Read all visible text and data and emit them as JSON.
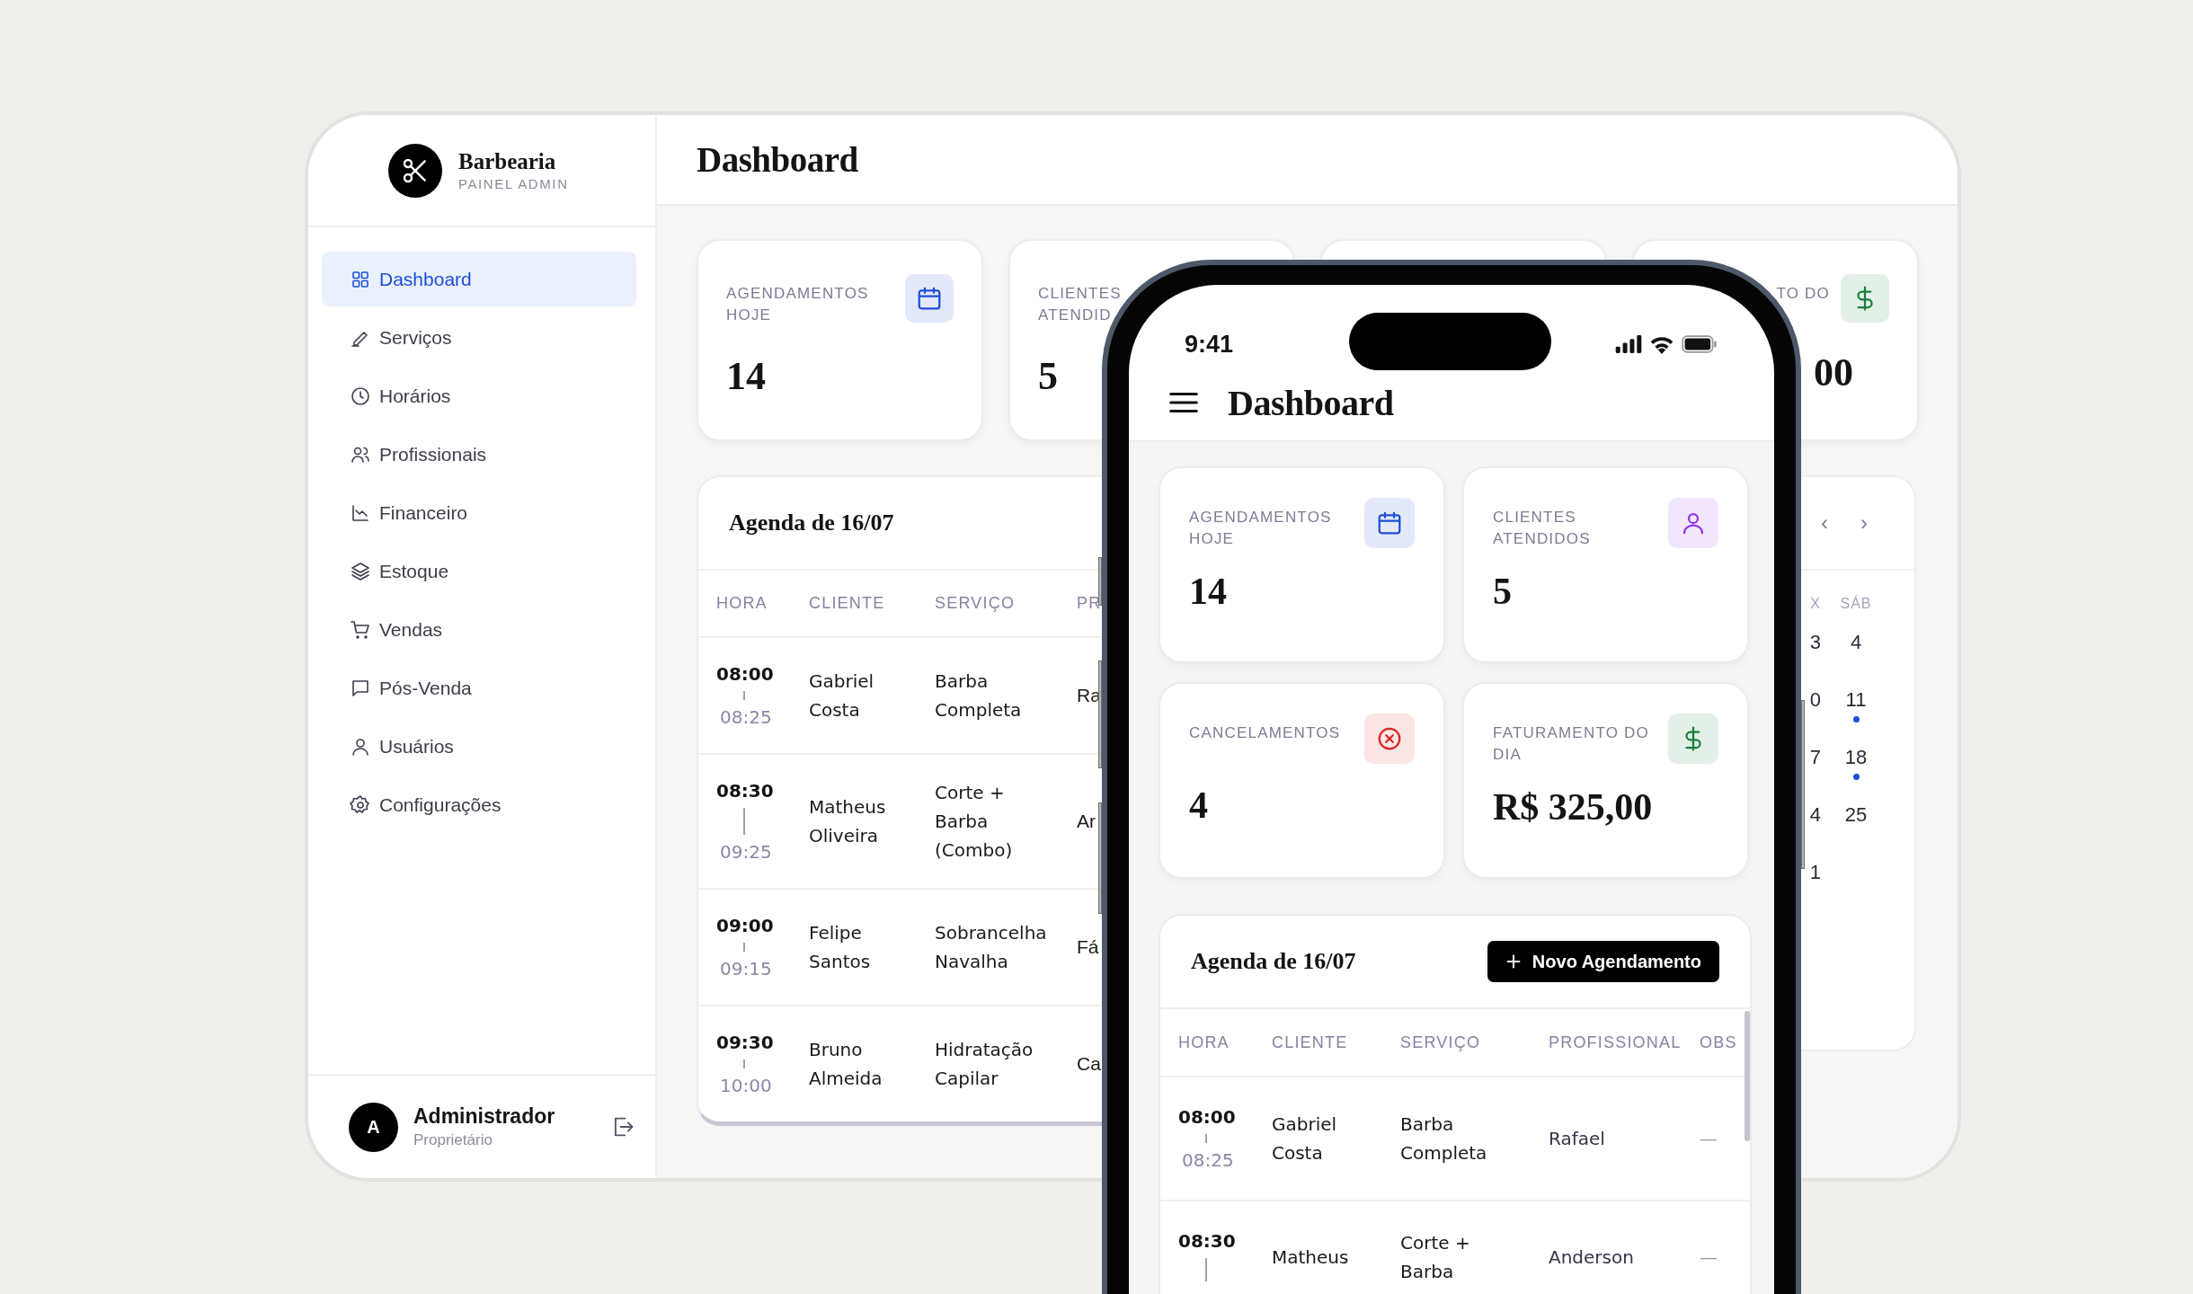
{
  "sidebar": {
    "brand": {
      "name": "Barbearia",
      "subtitle": "PAINEL ADMIN"
    },
    "items": [
      {
        "label": "Dashboard",
        "selected": true
      },
      {
        "label": "Serviços",
        "selected": false
      },
      {
        "label": "Horários",
        "selected": false
      },
      {
        "label": "Profissionais",
        "selected": false
      },
      {
        "label": "Financeiro",
        "selected": false
      },
      {
        "label": "Estoque",
        "selected": false
      },
      {
        "label": "Vendas",
        "selected": false
      },
      {
        "label": "Pós-Venda",
        "selected": false
      },
      {
        "label": "Usuários",
        "selected": false
      },
      {
        "label": "Configurações",
        "selected": false
      }
    ],
    "user": {
      "initial": "A",
      "name": "Administrador",
      "role": "Proprietário"
    }
  },
  "header": {
    "title": "Dashboard"
  },
  "stat_cards": [
    {
      "kind": "stat",
      "label": "AGENDAMENTOS HOJE",
      "value": "14",
      "color": "#1d4ed8"
    },
    {
      "kind": "stat",
      "label": "CLIENTES ATENDID",
      "value": "5"
    },
    {
      "kind": "covered"
    },
    {
      "kind": "stat",
      "label": "TO DO",
      "value": "00",
      "color": "#15803d"
    }
  ],
  "agenda": {
    "title": "Agenda de 16/07",
    "columns": [
      "HORA",
      "CLIENTE",
      "SERVIÇO",
      "PR"
    ],
    "rows": [
      {
        "start": "08:00",
        "end": "08:25",
        "client": "Gabriel Costa",
        "service": "Barba Completa",
        "column_4": "Ra"
      },
      {
        "start": "08:30",
        "end": "09:25",
        "client": "Matheus Oliveira",
        "service": "Corte + Barba (Combo)",
        "column_4": "Ar"
      },
      {
        "start": "09:00",
        "end": "09:15",
        "client": "Felipe Santos",
        "service": "Sobrancelha Navalha",
        "column_4": "Fá"
      },
      {
        "start": "09:30",
        "end": "10:00",
        "client": "Bruno Almeida",
        "service": "Hidratação Capilar",
        "column_4": "Ca"
      }
    ]
  },
  "calendar": {
    "nav": [
      "‹",
      "›"
    ],
    "columns": [
      "X",
      "SÁB"
    ],
    "weeks": [
      [
        {
          "day": "3",
          "event": false
        },
        {
          "day": "4",
          "event": false
        }
      ],
      [
        {
          "day": "0",
          "event": false
        },
        {
          "day": "11",
          "event": true
        }
      ],
      [
        {
          "day": "7",
          "event": false
        },
        {
          "day": "18",
          "event": true
        }
      ],
      [
        {
          "day": "4",
          "event": false
        },
        {
          "day": "25",
          "event": false
        }
      ],
      [
        {
          "day": "1",
          "event": false
        }
      ]
    ]
  },
  "phone": {
    "status_bar": {
      "time": "9:41"
    },
    "header": {
      "title": "Dashboard"
    },
    "stat_cards": [
      {
        "label": "AGENDAMENTOS HOJE",
        "value": "14",
        "color": "#1d4ed8"
      },
      {
        "label": "CLIENTES ATENDIDOS",
        "value": "5",
        "color": "#9333ea"
      },
      {
        "label": "CANCELAMENTOS",
        "value": "4",
        "color": "#dc2626"
      },
      {
        "label": "FATURAMENTO DO DIA",
        "value": "R$ 325,00",
        "color": "#15803d"
      }
    ],
    "agenda": {
      "title": "Agenda de 16/07",
      "button": "Novo Agendamento",
      "columns": [
        "HORA",
        "CLIENTE",
        "SERVIÇO",
        "PROFISSIONAL",
        "OBS"
      ],
      "rows": [
        {
          "start": "08:00",
          "end": "08:25",
          "client": "Gabriel Costa",
          "service": "Barba Completa",
          "professional": "Rafael",
          "obs": "—"
        },
        {
          "start": "08:30",
          "client": "Matheus",
          "service": "Corte + Barba",
          "professional": "Anderson",
          "obs": "—"
        }
      ]
    }
  }
}
